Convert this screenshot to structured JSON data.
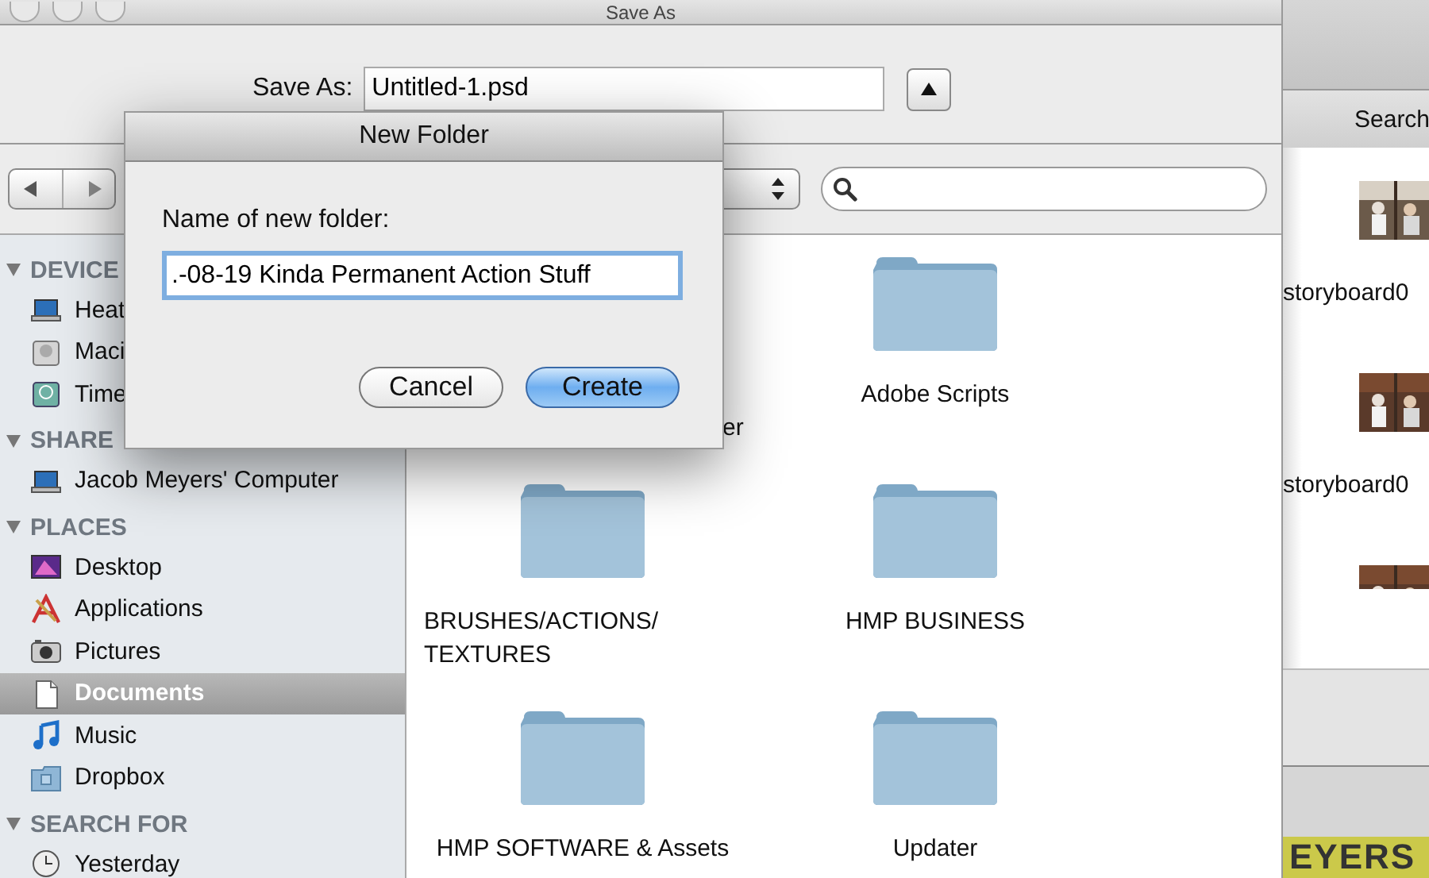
{
  "save_window": {
    "title": "Save As",
    "save_as_label": "Save As:",
    "filename": "Untitled-1.psd",
    "sidebar": [
      {
        "heading": "DEVICE",
        "items": [
          {
            "label": "Heat",
            "kind": "laptop",
            "selected": false
          },
          {
            "label": "Maci",
            "kind": "disk",
            "selected": false
          },
          {
            "label": "Time",
            "kind": "timemachine",
            "selected": false
          }
        ]
      },
      {
        "heading": "SHARE",
        "items": [
          {
            "label": "Jacob Meyers' Computer",
            "kind": "laptop",
            "selected": false
          }
        ]
      },
      {
        "heading": "PLACES",
        "items": [
          {
            "label": "Desktop",
            "kind": "desktop",
            "selected": false
          },
          {
            "label": "Applications",
            "kind": "apps",
            "selected": false
          },
          {
            "label": "Pictures",
            "kind": "camera",
            "selected": false
          },
          {
            "label": "Documents",
            "kind": "document",
            "selected": true
          },
          {
            "label": "Music",
            "kind": "music",
            "selected": false
          },
          {
            "label": "Dropbox",
            "kind": "dropbox",
            "selected": false
          }
        ]
      },
      {
        "heading": "SEARCH FOR",
        "items": [
          {
            "label": "Yesterday",
            "kind": "clock",
            "selected": false
          }
        ]
      }
    ],
    "hidden_label": "er",
    "folders": [
      {
        "label": "Adobe Scripts"
      },
      {
        "label": "BRUSHES/ACTIONS/ TEXTURES"
      },
      {
        "label": "HMP BUSINESS"
      },
      {
        "label": "HMP SOFTWARE & Assets"
      },
      {
        "label": "Updater"
      }
    ]
  },
  "new_folder_dialog": {
    "title": "New Folder",
    "prompt": "Name of new folder:",
    "value": ".-08-19 Kinda Permanent Action Stuff",
    "buttons": [
      {
        "label": "Cancel",
        "kind": "normal"
      },
      {
        "label": "Create",
        "kind": "default"
      }
    ]
  },
  "background_window": {
    "header": "Search",
    "items": [
      {
        "label": "storyboard0"
      },
      {
        "label": "storyboard0"
      },
      {
        "kind": "picture"
      }
    ],
    "footer_text": "EYERS"
  }
}
